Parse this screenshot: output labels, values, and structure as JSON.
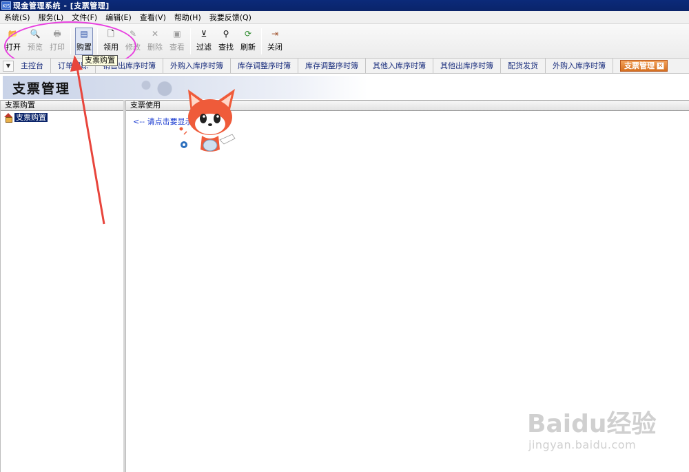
{
  "window": {
    "title": "现金管理系统 - [支票管理]",
    "app_icon": "KIS"
  },
  "menu": [
    "系统(S)",
    "服务(L)",
    "文件(F)",
    "编辑(E)",
    "查看(V)",
    "帮助(H)",
    "我要反馈(Q)"
  ],
  "toolbar": [
    {
      "icon": "open-folder-icon",
      "glyph": "📂",
      "label": "打开",
      "enabled": true
    },
    {
      "icon": "preview-icon",
      "glyph": "🔍",
      "label": "预览",
      "enabled": false
    },
    {
      "icon": "print-icon",
      "glyph": "🖶",
      "label": "打印",
      "enabled": false
    },
    {
      "icon": "purchase-icon",
      "glyph": "▤",
      "label": "购置",
      "enabled": true,
      "active": true
    },
    {
      "icon": "new-doc-icon",
      "glyph": "🗋",
      "label": "领用",
      "enabled": true
    },
    {
      "icon": "edit-icon",
      "glyph": "✎",
      "label": "修改",
      "enabled": false
    },
    {
      "icon": "delete-icon",
      "glyph": "✕",
      "label": "删除",
      "enabled": false
    },
    {
      "icon": "view-icon",
      "glyph": "▣",
      "label": "查看",
      "enabled": false
    },
    {
      "icon": "filter-icon",
      "glyph": "⊻",
      "label": "过滤",
      "enabled": true
    },
    {
      "icon": "binoculars-icon",
      "glyph": "⚲",
      "label": "查找",
      "enabled": true
    },
    {
      "icon": "refresh-icon",
      "glyph": "⟳",
      "label": "刷新",
      "enabled": true
    },
    {
      "icon": "exit-door-icon",
      "glyph": "⇥",
      "label": "关闭",
      "enabled": true
    }
  ],
  "tooltip": "支票购置",
  "tabs": [
    "主控台",
    "订单跟踪",
    "销售出库序时簿",
    "外购入库序时簿",
    "库存调整序时簿",
    "库存调整序时簿",
    "其他入库序时簿",
    "其他出库序时簿",
    "配货发货",
    "外购入库序时簿"
  ],
  "active_tab": "支票管理",
  "banner_title": "支票管理",
  "left_panel": {
    "header": "支票购置",
    "tree_item": "支票购置"
  },
  "right_panel": {
    "header": "支票使用",
    "hint": "<-- 请点击要显示的"
  },
  "watermark": {
    "brand": "Baidu经验",
    "url": "jingyan.baidu.com"
  },
  "colors": {
    "titlebar": "#0a246a",
    "annotation": "#e83fe0",
    "arrow": "#e8453c",
    "active_tab": "#e07a2a",
    "link_text": "#1a3bd1"
  }
}
